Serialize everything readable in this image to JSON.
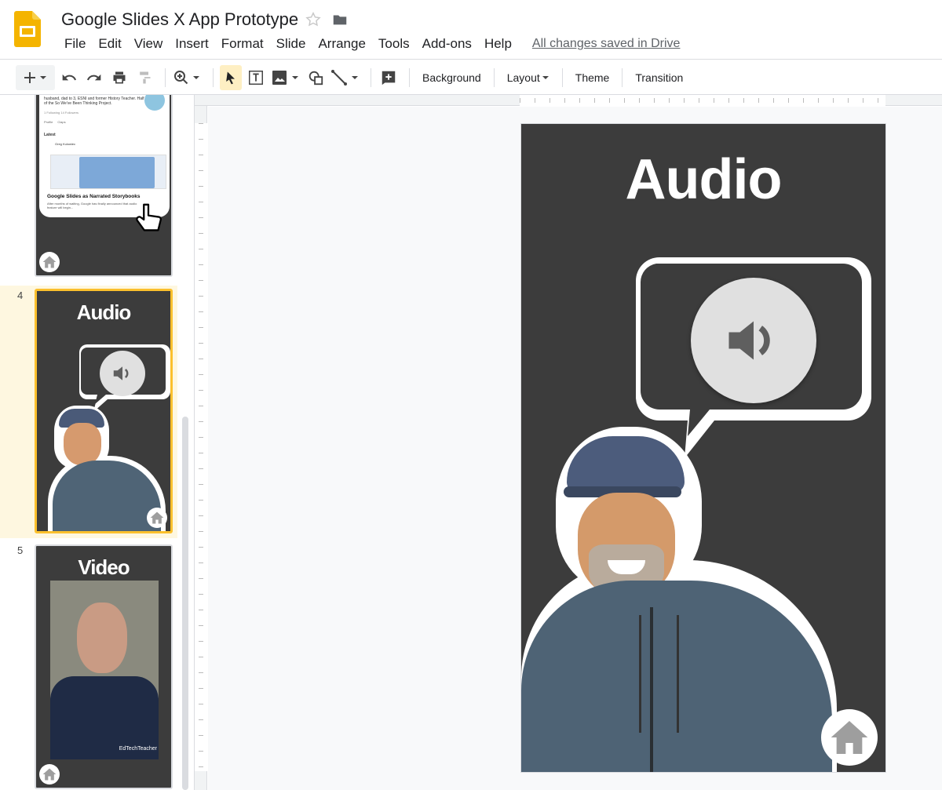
{
  "app": {
    "title": "Google Slides X App Prototype",
    "save_status": "All changes saved in Drive"
  },
  "menu": [
    "File",
    "Edit",
    "View",
    "Insert",
    "Format",
    "Slide",
    "Arrange",
    "Tools",
    "Add-ons",
    "Help"
  ],
  "toolbar": {
    "background_label": "Background",
    "layout_label": "Layout",
    "theme_label": "Theme",
    "transition_label": "Transition"
  },
  "filmstrip": {
    "slide3": {
      "bio_text": "husband, dad to 3, ESNI and former History Teacher. Half of the So We've Been Thinking Project.",
      "follow_text": "1 Following    14 Followers",
      "tab_profile": "Profile",
      "tab_claps": "Claps",
      "latest_label": "Latest",
      "author": "Greg Kulowiec",
      "post_title": "Google Slides as Narrated Storybooks",
      "post_excerpt": "After months of waiting, Google has finally announced that audio feature will begin..."
    },
    "slide4": {
      "number": "4",
      "title": "Audio"
    },
    "slide5": {
      "number": "5",
      "title": "Video",
      "brand": "EdTechTeacher"
    }
  },
  "slide": {
    "title": "Audio"
  },
  "colors": {
    "slide_bg": "#3c3c3c",
    "accent": "#fbc02d",
    "logo": "#f4b400"
  }
}
